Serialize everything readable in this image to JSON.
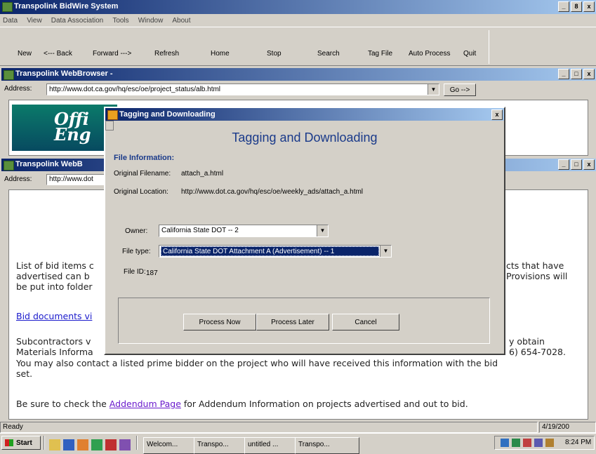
{
  "app": {
    "title": "Transpolink BidWire System",
    "menu": [
      "Data",
      "View",
      "Data Association",
      "Tools",
      "Window",
      "About"
    ],
    "toolbar": {
      "new": "New",
      "back": "<--- Back",
      "forward": "Forward --->",
      "refresh": "Refresh",
      "home": "Home",
      "stop": "Stop",
      "search": "Search",
      "tagfile": "Tag File",
      "autoprocess": "Auto Process",
      "quit": "Quit"
    },
    "win_buttons": {
      "min": "_",
      "max": "8",
      "close": "x"
    }
  },
  "browser1": {
    "title": "Transpolink WebBrowser -",
    "address_label": "Address:",
    "address": "http://www.dot.ca.gov/hq/esc/oe/project_status/alb.html",
    "go": "Go -->",
    "logo_text": "Offi\nEng"
  },
  "browser2": {
    "title": "Transpolink WebB",
    "address_label": "Address:",
    "address": "http://www.dot",
    "content": {
      "p1a": "List of bid items c",
      "p1b": "advertised can b",
      "p1c": "be put into folder",
      "p1r1": "cts that have",
      "p1r2": "Provisions will",
      "link1": "Bid documents vi",
      "p2a": "Subcontractors v",
      "p2b": "Materials Informa",
      "p2r1": "y obtain",
      "p2r2": "6) 654-7028.",
      "p3": "You may also contact a listed prime bidder on the project who will have received this information with the bid",
      "p3b": "set.",
      "p4_pre": "Be sure to check the ",
      "p4_link": "Addendum Page",
      "p4_post": " for Addendum Information on projects advertised and out to bid."
    }
  },
  "dialog": {
    "title": "Tagging and Downloading",
    "heading": "Tagging and Downloading",
    "section": "File Information:",
    "orig_filename_label": "Original Filename:",
    "orig_filename": "attach_a.html",
    "orig_location_label": "Original Location:",
    "orig_location": "http://www.dot.ca.gov/hq/esc/oe/weekly_ads/attach_a.html",
    "owner_label": "Owner:",
    "owner_value": "California State DOT -- 2",
    "filetype_label": "File type:",
    "filetype_value": "California State DOT Attachment A (Advertisement) -- 1",
    "fileid_label": "File ID:",
    "fileid_value": "187",
    "process_now": "Process Now",
    "process_later": "Process Later",
    "cancel": "Cancel",
    "close": "x"
  },
  "status": {
    "text": "Ready",
    "date": "4/19/200"
  },
  "taskbar": {
    "start": "Start",
    "tasks": [
      "Welcom...",
      "Transpo...",
      "untitled ...",
      "Transpo..."
    ],
    "clock": "8:24 PM"
  }
}
